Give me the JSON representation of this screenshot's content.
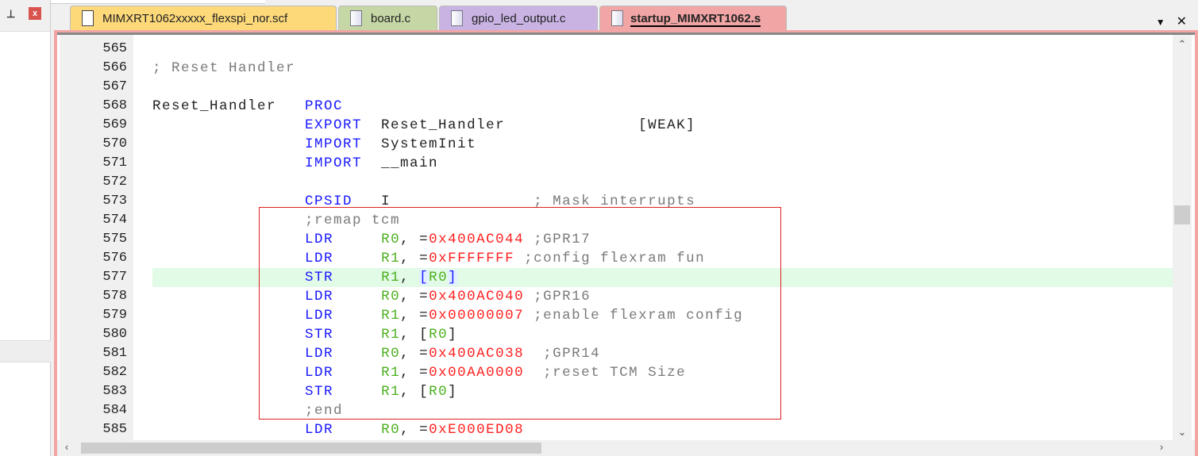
{
  "left_panel": {
    "pin_icon": "pin-icon",
    "close_label": "x"
  },
  "tabs": [
    {
      "label": "MIMXRT1062xxxxx_flexspi_nor.scf",
      "color": "#fdd97a",
      "active": false
    },
    {
      "label": "board.c",
      "color": "#c5d7a5",
      "active": false
    },
    {
      "label": "gpio_led_output.c",
      "color": "#c9b3e3",
      "active": false
    },
    {
      "label": "startup_MIMXRT1062.s",
      "color": "#f2a5a5",
      "active": true
    }
  ],
  "tab_controls": {
    "dropdown": "▼",
    "close": "✕"
  },
  "editor": {
    "highlight_line": 577,
    "lines": [
      {
        "n": "565",
        "seg": []
      },
      {
        "n": "566",
        "seg": [
          [
            "; Reset Handler",
            "c"
          ]
        ]
      },
      {
        "n": "567",
        "seg": []
      },
      {
        "n": "568",
        "seg": [
          [
            "Reset_Handler   ",
            "t"
          ],
          [
            "PROC",
            "k"
          ]
        ]
      },
      {
        "n": "569",
        "seg": [
          [
            "                ",
            "t"
          ],
          [
            "EXPORT",
            "k"
          ],
          [
            "  Reset_Handler              [WEAK]",
            "t"
          ]
        ]
      },
      {
        "n": "570",
        "seg": [
          [
            "                ",
            "t"
          ],
          [
            "IMPORT",
            "k"
          ],
          [
            "  SystemInit",
            "t"
          ]
        ]
      },
      {
        "n": "571",
        "seg": [
          [
            "                ",
            "t"
          ],
          [
            "IMPORT",
            "k"
          ],
          [
            "  __main",
            "t"
          ]
        ]
      },
      {
        "n": "572",
        "seg": []
      },
      {
        "n": "573",
        "seg": [
          [
            "                ",
            "t"
          ],
          [
            "CPSID",
            "k"
          ],
          [
            "   I               ",
            "t"
          ],
          [
            "; Mask interrupts",
            "c"
          ]
        ]
      },
      {
        "n": "574",
        "seg": [
          [
            "                ",
            "t"
          ],
          [
            ";remap tcm",
            "c"
          ]
        ]
      },
      {
        "n": "575",
        "seg": [
          [
            "                ",
            "t"
          ],
          [
            "LDR",
            "k"
          ],
          [
            "     ",
            "t"
          ],
          [
            "R0",
            "r"
          ],
          [
            ", =",
            "t"
          ],
          [
            "0x400AC044",
            "n"
          ],
          [
            " ;GPR17",
            "c"
          ]
        ]
      },
      {
        "n": "576",
        "seg": [
          [
            "                ",
            "t"
          ],
          [
            "LDR",
            "k"
          ],
          [
            "     ",
            "t"
          ],
          [
            "R1",
            "r"
          ],
          [
            ", =",
            "t"
          ],
          [
            "0xFFFFFFF",
            "n"
          ],
          [
            " ;config flexram fun",
            "c"
          ]
        ]
      },
      {
        "n": "577",
        "seg": [
          [
            "                ",
            "t"
          ],
          [
            "STR",
            "k"
          ],
          [
            "     ",
            "t"
          ],
          [
            "R1",
            "r"
          ],
          [
            ", ",
            "t"
          ],
          [
            "[",
            "b"
          ],
          [
            "R0",
            "r"
          ],
          [
            "]",
            "b"
          ]
        ]
      },
      {
        "n": "578",
        "seg": [
          [
            "                ",
            "t"
          ],
          [
            "LDR",
            "k"
          ],
          [
            "     ",
            "t"
          ],
          [
            "R0",
            "r"
          ],
          [
            ", =",
            "t"
          ],
          [
            "0x400AC040",
            "n"
          ],
          [
            " ;GPR16",
            "c"
          ]
        ]
      },
      {
        "n": "579",
        "seg": [
          [
            "                ",
            "t"
          ],
          [
            "LDR",
            "k"
          ],
          [
            "     ",
            "t"
          ],
          [
            "R1",
            "r"
          ],
          [
            ", =",
            "t"
          ],
          [
            "0x00000007",
            "n"
          ],
          [
            " ;enable flexram config",
            "c"
          ]
        ]
      },
      {
        "n": "580",
        "seg": [
          [
            "                ",
            "t"
          ],
          [
            "STR",
            "k"
          ],
          [
            "     ",
            "t"
          ],
          [
            "R1",
            "r"
          ],
          [
            ", [",
            "t"
          ],
          [
            "R0",
            "r"
          ],
          [
            "]",
            "t"
          ]
        ]
      },
      {
        "n": "581",
        "seg": [
          [
            "                ",
            "t"
          ],
          [
            "LDR",
            "k"
          ],
          [
            "     ",
            "t"
          ],
          [
            "R0",
            "r"
          ],
          [
            ", =",
            "t"
          ],
          [
            "0x400AC038",
            "n"
          ],
          [
            "  ;GPR14",
            "c"
          ]
        ]
      },
      {
        "n": "582",
        "seg": [
          [
            "                ",
            "t"
          ],
          [
            "LDR",
            "k"
          ],
          [
            "     ",
            "t"
          ],
          [
            "R1",
            "r"
          ],
          [
            ", =",
            "t"
          ],
          [
            "0x00AA0000",
            "n"
          ],
          [
            "  ;reset TCM Size",
            "c"
          ]
        ]
      },
      {
        "n": "583",
        "seg": [
          [
            "                ",
            "t"
          ],
          [
            "STR",
            "k"
          ],
          [
            "     ",
            "t"
          ],
          [
            "R1",
            "r"
          ],
          [
            ", [",
            "t"
          ],
          [
            "R0",
            "r"
          ],
          [
            "]",
            "t"
          ]
        ]
      },
      {
        "n": "584",
        "seg": [
          [
            "                ",
            "t"
          ],
          [
            ";end",
            "c"
          ]
        ]
      },
      {
        "n": "585",
        "seg": [
          [
            "                ",
            "t"
          ],
          [
            "LDR",
            "k"
          ],
          [
            "     ",
            "t"
          ],
          [
            "R0",
            "r"
          ],
          [
            ", =",
            "t"
          ],
          [
            "0xE000ED08",
            "n"
          ]
        ]
      }
    ]
  }
}
